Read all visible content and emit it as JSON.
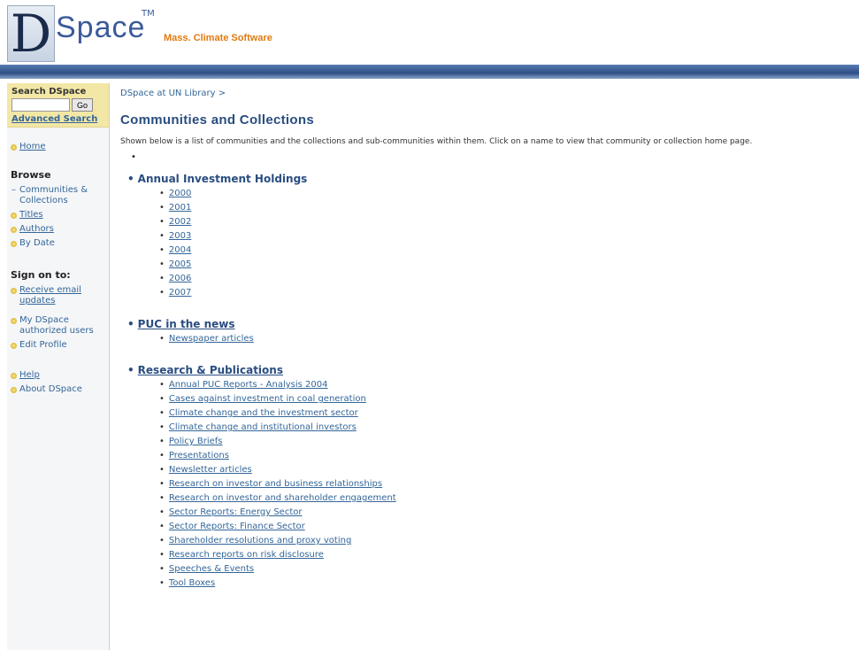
{
  "header": {
    "logo_letter": "D",
    "logo_word": "Space",
    "logo_tm": "TM",
    "tagline": "Mass. Climate Software"
  },
  "sidebar": {
    "search_label": "Search DSpace",
    "search_placeholder": "",
    "go_label": "Go",
    "advanced_label": "Advanced Search",
    "home_label": "Home",
    "browse_heading": "Browse",
    "browse_items": [
      "Communities & Collections",
      "Titles",
      "Authors",
      "By Date"
    ],
    "sign_on_heading": "Sign on to:",
    "sign_on_items": [
      "Receive email updates",
      "My DSpace authorized users",
      "Edit Profile"
    ],
    "help_items": [
      "Help",
      "About DSpace"
    ]
  },
  "main": {
    "breadcrumb": "DSpace at UN Library >",
    "title": "Communities and Collections",
    "intro": "Shown below is a list of communities and the collections and sub-communities within them. Click on a name to view that community or collection home page.",
    "lone_bullet": "•",
    "communities": [
      {
        "name": "Annual Investment Holdings",
        "linked": false,
        "collections": [
          "2000",
          "2001",
          "2002",
          "2003",
          "2004",
          "2005",
          "2006",
          "2007"
        ]
      },
      {
        "name": "PUC in the news",
        "linked": true,
        "collections": [
          "Newspaper articles"
        ]
      },
      {
        "name": "Research & Publications",
        "linked": true,
        "collections": [
          "Annual PUC Reports - Analysis 2004",
          "Cases against investment in coal generation",
          "Climate change and the investment sector",
          "Climate change and institutional investors",
          "Policy Briefs",
          "Presentations",
          "Newsletter articles",
          "Research on investor and business relationships",
          "Research on investor and shareholder engagement",
          "Sector Reports: Energy Sector",
          "Sector Reports: Finance Sector",
          "Shareholder resolutions and proxy voting",
          "Research reports on risk disclosure",
          "Speeches & Events",
          "Tool Boxes"
        ]
      }
    ]
  },
  "colors": {
    "accent": "#2a4d80",
    "link": "#336699",
    "tagline": "#e07a10",
    "search_bg": "#f3e7a6"
  }
}
